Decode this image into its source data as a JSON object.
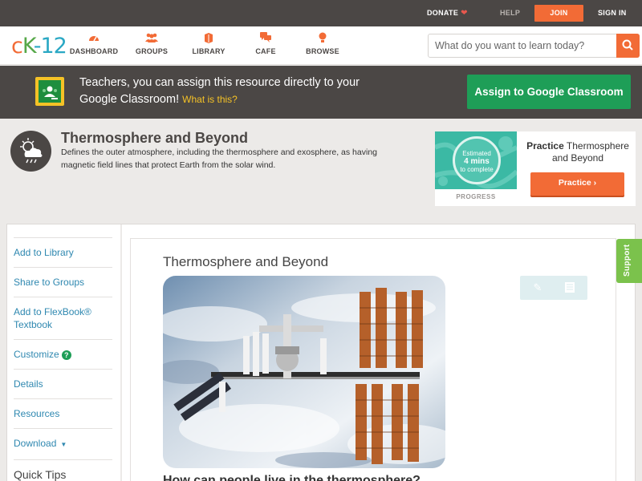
{
  "topbar": {
    "donate": "DONATE",
    "help": "HELP",
    "join": "JOIN",
    "sign_in": "SIGN IN"
  },
  "logo": {
    "c": "c",
    "k": "K",
    "n": "-12"
  },
  "nav": {
    "items": [
      {
        "label": "DASHBOARD",
        "icon": "dashboard-icon"
      },
      {
        "label": "GROUPS",
        "icon": "groups-icon"
      },
      {
        "label": "LIBRARY",
        "icon": "library-icon"
      },
      {
        "label": "CAFE",
        "icon": "cafe-icon"
      },
      {
        "label": "BROWSE",
        "icon": "browse-icon"
      }
    ],
    "search_placeholder": "What do you want to learn today?"
  },
  "google_banner": {
    "message": "Teachers, you can assign this resource directly to your Google Classroom!",
    "what_link": "What is this?",
    "button": "Assign to Google Classroom"
  },
  "concept": {
    "title": "Thermosphere and Beyond",
    "description": "Defines the outer atmosphere, including the thermosphere and exosphere, as having magnetic field lines that protect Earth from the solar wind.",
    "progress": {
      "estimated": "Estimated",
      "mins": "4 mins",
      "to_complete": "to complete",
      "label": "PROGRESS"
    },
    "practice": {
      "prefix": "Practice",
      "title": "Thermosphere and Beyond",
      "button": "Practice"
    }
  },
  "sidebar": {
    "items": [
      {
        "label": "Add to Library"
      },
      {
        "label": "Share to Groups"
      },
      {
        "label": "Add to FlexBook® Textbook"
      },
      {
        "label": "Customize"
      },
      {
        "label": "Details"
      },
      {
        "label": "Resources"
      },
      {
        "label": "Download"
      },
      {
        "label": "Quick Tips"
      }
    ]
  },
  "reader": {
    "title": "Thermosphere and Beyond",
    "heading": "How can people live in the thermosphere?"
  },
  "support": "Support",
  "colors": {
    "brand_orange": "#f26b36",
    "brand_green": "#1e9e57",
    "dark_bar": "#4b4745",
    "link_blue": "#2f88b0",
    "support_green": "#7bc24c"
  }
}
